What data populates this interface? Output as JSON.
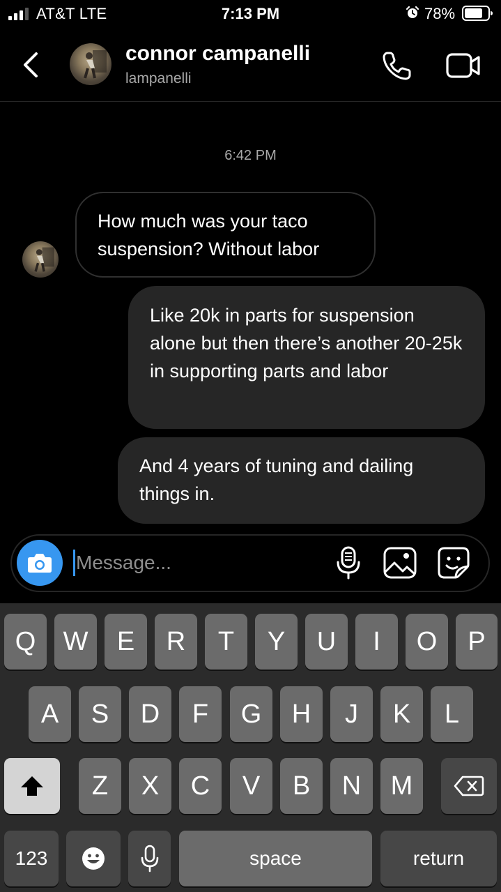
{
  "status_bar": {
    "carrier": "AT&T  LTE",
    "time": "7:13 PM",
    "battery_pct": "78%",
    "battery_level": 0.78
  },
  "header": {
    "name": "connor campanelli",
    "handle": "lampanelli",
    "back_icon": "chevron-left-icon",
    "call_icon": "phone-icon",
    "video_icon": "video-camera-icon"
  },
  "conversation": {
    "timestamp": "6:42 PM",
    "messages": [
      {
        "direction": "incoming",
        "text": "How much was your taco suspension? Without labor"
      },
      {
        "direction": "outgoing",
        "text": "Like 20k in parts for suspension alone but then there’s another 20-25k in supporting parts and labor"
      },
      {
        "direction": "outgoing",
        "text": "And 4 years of tuning and dailing things in."
      }
    ]
  },
  "composer": {
    "placeholder": "Message...",
    "value": "",
    "icons": [
      "camera-icon",
      "microphone-icon",
      "gallery-icon",
      "sticker-icon"
    ]
  },
  "keyboard": {
    "row1": [
      "Q",
      "W",
      "E",
      "R",
      "T",
      "Y",
      "U",
      "I",
      "O",
      "P"
    ],
    "row2": [
      "A",
      "S",
      "D",
      "F",
      "G",
      "H",
      "J",
      "K",
      "L"
    ],
    "row3": [
      "Z",
      "X",
      "C",
      "V",
      "B",
      "N",
      "M"
    ],
    "numbers_label": "123",
    "space_label": "space",
    "return_label": "return"
  },
  "colors": {
    "background": "#000000",
    "bubble_outgoing": "#262626",
    "accent": "#3797f0",
    "keyboard_bg": "#2b2b2b",
    "key": "#6b6b6b"
  }
}
